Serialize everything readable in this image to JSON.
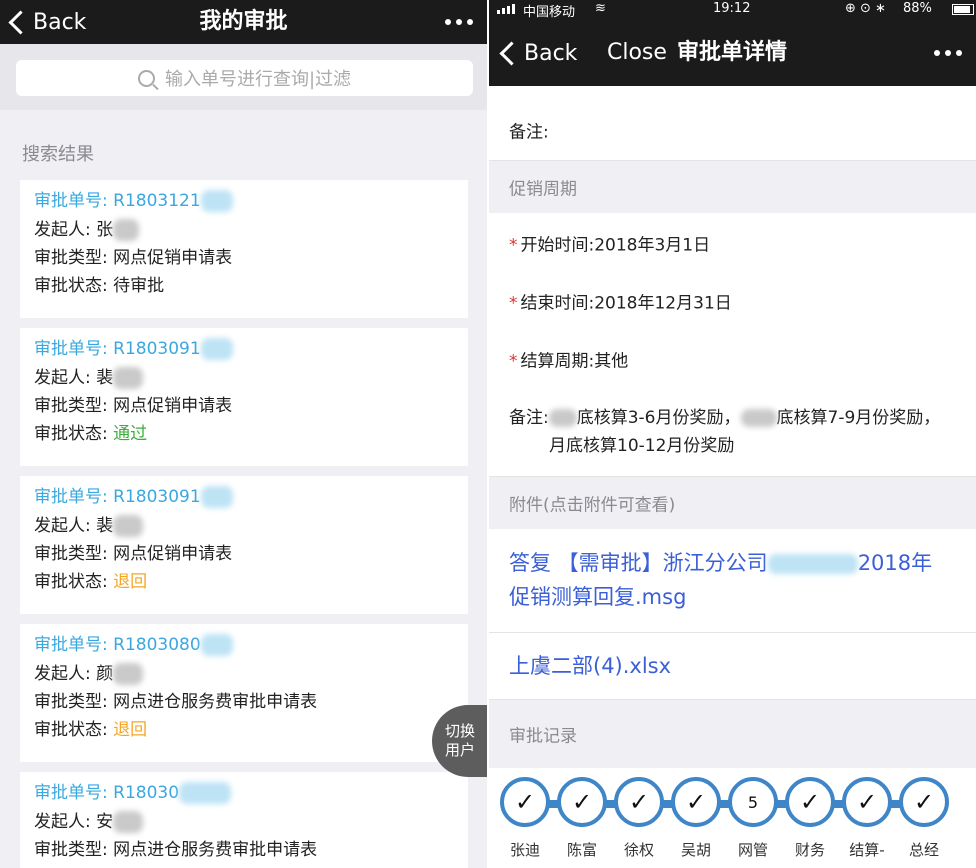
{
  "left": {
    "nav": {
      "back": "Back",
      "title": "我的审批"
    },
    "search": {
      "placeholder": "输入单号进行查询|过滤"
    },
    "section": "搜索结果",
    "cards": [
      {
        "id": "审批单号: R1803121",
        "initiator": "发起人: 张",
        "type": "审批类型: 网点促销申请表",
        "status_label": "审批状态: ",
        "status": "待审批"
      },
      {
        "id": "审批单号: R1803091",
        "initiator": "发起人: 裴",
        "type": "审批类型: 网点促销申请表",
        "status_label": "审批状态: ",
        "status": "通过"
      },
      {
        "id": "审批单号: R1803091",
        "initiator": "发起人: 裴",
        "type": "审批类型: 网点促销申请表",
        "status_label": "审批状态: ",
        "status": "退回"
      },
      {
        "id": "审批单号: R1803080",
        "initiator": "发起人: 颜",
        "type": "审批类型: 网点进仓服务费审批申请表",
        "status_label": "审批状态: ",
        "status": "退回"
      },
      {
        "id": "审批单号: R18030",
        "initiator": "发起人: 安",
        "type": "审批类型: 网点进仓服务费审批申请表"
      }
    ],
    "switch_button": [
      "切换",
      "用户"
    ]
  },
  "right": {
    "statusbar": {
      "carrier": "中国移动",
      "time": "19:12",
      "battery": "88%"
    },
    "nav": {
      "back": "Back",
      "close": "Close",
      "title": "审批单详情"
    },
    "remark_top": "备注:",
    "promo_section": "促销周期",
    "start": "开始时间:2018年3月1日",
    "end": "结束时间:2018年12月31日",
    "settle": "结算周期:其他",
    "remark_label": "备注:",
    "remark_line1a": "底核算3-6月份奖励，",
    "remark_line1b": "底核算7-9月份奖励，",
    "remark_line2": "月底核算10-12月份奖励",
    "attach_section": "附件(点击附件可查看)",
    "attach1_a": "答复 【需审批】浙江分公司",
    "attach1_b": "2018年",
    "attach1_c": "促销测算回复.msg",
    "attach2": "上虞二部(4).xlsx",
    "record_section": "审批记录",
    "approvers": [
      {
        "name": "张迪",
        "mark": "✓"
      },
      {
        "name": "陈富",
        "mark": "✓"
      },
      {
        "name": "徐权",
        "mark": "✓"
      },
      {
        "name": "吴胡",
        "mark": "✓"
      },
      {
        "name": "网管",
        "mark": "5"
      },
      {
        "name": "财务",
        "mark": "✓"
      },
      {
        "name": "结算-",
        "mark": "✓"
      },
      {
        "name": "总经",
        "mark": "✓"
      }
    ],
    "colors": {
      "link": "#3b5fd6",
      "accent": "#3aa8e0",
      "pass": "#3cae3c",
      "return": "#f5a623",
      "ring": "#3f86c8"
    }
  }
}
